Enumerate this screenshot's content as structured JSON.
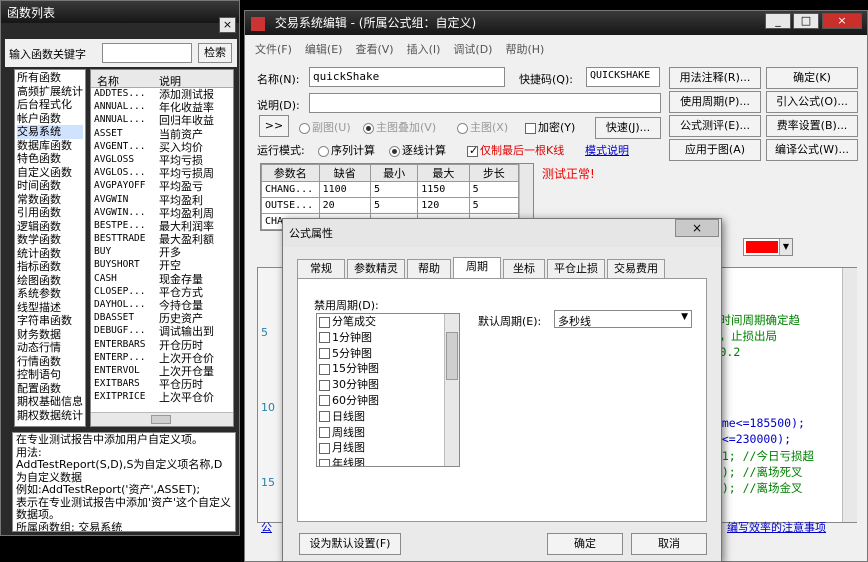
{
  "func_panel": {
    "title": "函数列表",
    "close": "×",
    "search_label": "输入函数关键字",
    "search_button": "检索",
    "categories": [
      "所有函数",
      "高频扩展统计",
      "后台程式化",
      "帐户函数",
      "交易系统",
      "数据库函数",
      "特色函数",
      "自定义函数",
      "时间函数",
      "常数函数",
      "引用函数",
      "逻辑函数",
      "数学函数",
      "统计函数",
      "指标函数",
      "绘图函数",
      "系统参数",
      "线型描述",
      "字符串函数",
      "财务数据",
      "动态行情",
      "行情函数",
      "控制语句",
      "配置函数",
      "期权基础信息",
      "期权数据统计"
    ],
    "col_name": "名称",
    "col_desc": "说明",
    "functions": [
      {
        "name": "ADDTES...",
        "desc": "添加测试报"
      },
      {
        "name": "ANNUAL...",
        "desc": "年化收益率"
      },
      {
        "name": "ANNUAL...",
        "desc": "回归年收益"
      },
      {
        "name": "ASSET",
        "desc": "当前资产"
      },
      {
        "name": "AVGENT...",
        "desc": "买入均价"
      },
      {
        "name": "AVGLOSS",
        "desc": "平均亏损"
      },
      {
        "name": "AVGLOS...",
        "desc": "平均亏损周"
      },
      {
        "name": "AVGPAYOFF",
        "desc": "平均盈亏"
      },
      {
        "name": "AVGWIN",
        "desc": "平均盈利"
      },
      {
        "name": "AVGWIN...",
        "desc": "平均盈利周"
      },
      {
        "name": "BESTPE...",
        "desc": "最大利润率"
      },
      {
        "name": "BESTTRADE",
        "desc": "最大盈利额"
      },
      {
        "name": "BUY",
        "desc": "开多"
      },
      {
        "name": "BUYSHORT",
        "desc": "开空"
      },
      {
        "name": "CASH",
        "desc": "现金存量"
      },
      {
        "name": "CLOSEP...",
        "desc": "平仓方式"
      },
      {
        "name": "DAYHOL...",
        "desc": "今持仓量"
      },
      {
        "name": "DBASSET",
        "desc": "历史资产"
      },
      {
        "name": "DEBUGF...",
        "desc": "调试输出到"
      },
      {
        "name": "ENTERBARS",
        "desc": "开仓历时"
      },
      {
        "name": "ENTERP...",
        "desc": "上次开仓价"
      },
      {
        "name": "ENTERVOL",
        "desc": "上次开仓量"
      },
      {
        "name": "EXITBARS",
        "desc": "平仓历时"
      },
      {
        "name": "EXITPRICE",
        "desc": "上次平仓价"
      }
    ],
    "help_lines": [
      "在专业测试报告中添加用户自定义项。",
      "用法:",
      "AddTestReport(S,D),S为自定义项名称,D为自定义数据",
      "例如:AddTestReport('资产',ASSET);",
      "表示在专业测试报告中添加'资产'这个自定义数据项。",
      "所属函数组: 交易系统"
    ]
  },
  "editor": {
    "title": "交易系统编辑 - (所属公式组：自定义)",
    "menu": [
      "文件(F)",
      "编辑(E)",
      "查看(V)",
      "插入(I)",
      "调试(D)",
      "帮助(H)"
    ],
    "name_label": "名称(N):",
    "name_value": "quickShake",
    "shortcut_label": "快捷码(Q):",
    "shortcut_value": "QUICKSHAKE",
    "desc_label": "说明(D):",
    "desc_value": "",
    "expand_button": ">>",
    "chart_sub": "副图(U)",
    "chart_overlay": "主图叠加(V)",
    "chart_main": "主图(X)",
    "encrypt": "加密(Y)",
    "speed_button": "快速(J)...",
    "run_mode_label": "运行模式:",
    "mode_sequential": "序列计算",
    "mode_tick": "逐线计算",
    "only_last": "仅制最后一根K线",
    "mode_help_link": "模式说明",
    "status": "测试正常!",
    "right_buttons": [
      [
        "用法注释(R)...",
        "确定(K)"
      ],
      [
        "使用周期(P)...",
        "引入公式(O)..."
      ],
      [
        "公式测评(E)...",
        "费率设置(B)..."
      ],
      [
        "应用于图(A)",
        "编译公式(W)..."
      ]
    ],
    "params_headers": [
      "参数名",
      "缺省",
      "最小",
      "最大",
      "步长"
    ],
    "params": [
      [
        "CHANG...",
        "1100",
        "5",
        "1150",
        "5"
      ],
      [
        "OUTSE...",
        "20",
        "5",
        "120",
        "5"
      ],
      [
        "CHA...",
        "",
        "",
        "",
        ""
      ]
    ],
    "line_numbers": [
      "5",
      "10",
      "15"
    ],
    "code_right": [
      {
        "text": "大时间周期确定趋",
        "color": "#008000"
      },
      {
        "text": "势，止损出局",
        "color": "#008000"
      },
      {
        "text": "乏0.2",
        "color": "#008000"
      },
      {
        "text": "time<=185500);",
        "color": "#0000cc"
      },
      {
        "text": "me<=230000);",
        "color": "#0000cc"
      },
      {
        "text": "0.1; //今日亏损超",
        "color": "#008000"
      },
      {
        "text": "SE); //离场死叉",
        "color": "#008000"
      },
      {
        "text": "1)); //离场金叉",
        "color": "#008000"
      }
    ],
    "bottom_link_left": "公",
    "bottom_link_right": "编写效率的注意事项"
  },
  "dialog": {
    "title": "公式属性",
    "close": "×",
    "tabs": [
      "常规",
      "参数精灵",
      "帮助",
      "周期",
      "坐标",
      "平仓止损",
      "交易费用"
    ],
    "active_tab": "周期",
    "disabled_label": "禁用周期(D):",
    "periods": [
      "分笔成交",
      "1分钟图",
      "5分钟图",
      "15分钟图",
      "30分钟图",
      "60分钟图",
      "日线图",
      "周线图",
      "月线图",
      "年线图"
    ],
    "default_label": "默认周期(E):",
    "default_value": "多秒线",
    "set_default_button": "设为默认设置(F)",
    "ok_button": "确定",
    "cancel_button": "取消"
  },
  "colors": {
    "status_red": "#ff0000",
    "link_blue": "#0000cc",
    "swatch": "#ff0000"
  }
}
